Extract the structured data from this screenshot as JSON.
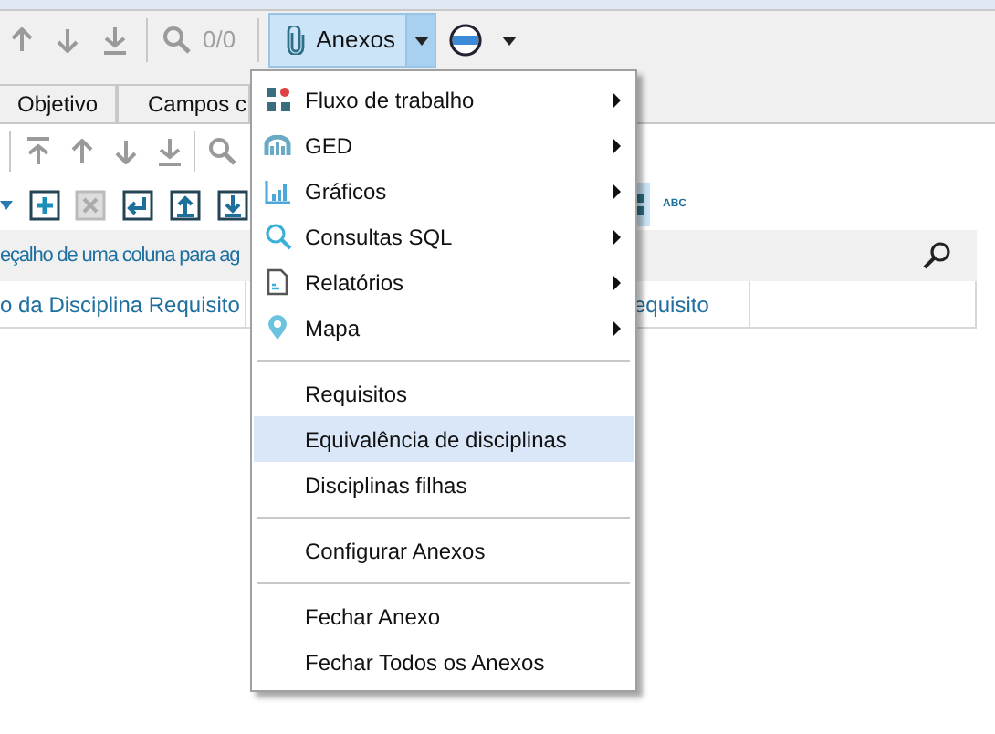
{
  "toolbar": {
    "counter": "0/0",
    "attachments_button": {
      "label": "Anexos",
      "expanded": true
    }
  },
  "tabs": [
    {
      "label": "Objetivo",
      "selected": false
    },
    {
      "label": "Campos c",
      "selected": false
    }
  ],
  "format_toolbar": {
    "abc_label": "ABC"
  },
  "group_panel": {
    "hint": "eçalho de uma coluna para ag"
  },
  "table": {
    "columns": [
      "o da Disciplina Requisito",
      "equisito"
    ]
  },
  "menu": {
    "items": [
      {
        "kind": "submenu",
        "label": "Fluxo de trabalho",
        "selected": false
      },
      {
        "kind": "submenu",
        "label": "GED",
        "selected": false
      },
      {
        "kind": "submenu",
        "label": "Gráficos",
        "selected": false
      },
      {
        "kind": "submenu",
        "label": "Consultas SQL",
        "selected": false
      },
      {
        "kind": "submenu",
        "label": "Relatórios",
        "selected": false
      },
      {
        "kind": "submenu",
        "label": "Mapa",
        "selected": false
      },
      {
        "kind": "separator"
      },
      {
        "kind": "item",
        "label": "Requisitos",
        "selected": false
      },
      {
        "kind": "item",
        "label": "Equivalência de disciplinas",
        "selected": true
      },
      {
        "kind": "item",
        "label": "Disciplinas filhas",
        "selected": false
      },
      {
        "kind": "separator"
      },
      {
        "kind": "item",
        "label": "Configurar Anexos",
        "selected": false
      },
      {
        "kind": "separator"
      },
      {
        "kind": "item",
        "label": "Fechar Anexo",
        "selected": false
      },
      {
        "kind": "item",
        "label": "Fechar Todos os Anexos",
        "selected": false
      }
    ]
  }
}
